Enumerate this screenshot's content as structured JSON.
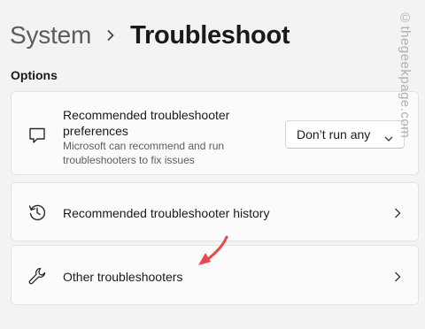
{
  "breadcrumb": {
    "parent": "System",
    "current": "Troubleshoot"
  },
  "section": {
    "label": "Options"
  },
  "cards": {
    "preferences": {
      "icon": "chat-bubble-icon",
      "title": "Recommended troubleshooter preferences",
      "description": "Microsoft can recommend and run troubleshooters to fix issues",
      "dropdown_value": "Don’t run any"
    },
    "history": {
      "icon": "history-icon",
      "title": "Recommended troubleshooter history"
    },
    "other": {
      "icon": "wrench-icon",
      "title": "Other troubleshooters"
    }
  },
  "watermark": "©thegeekpage.com",
  "colors": {
    "background": "#f3f3f3",
    "card": "#fbfbfb",
    "annotation_arrow": "#e84a4a"
  }
}
